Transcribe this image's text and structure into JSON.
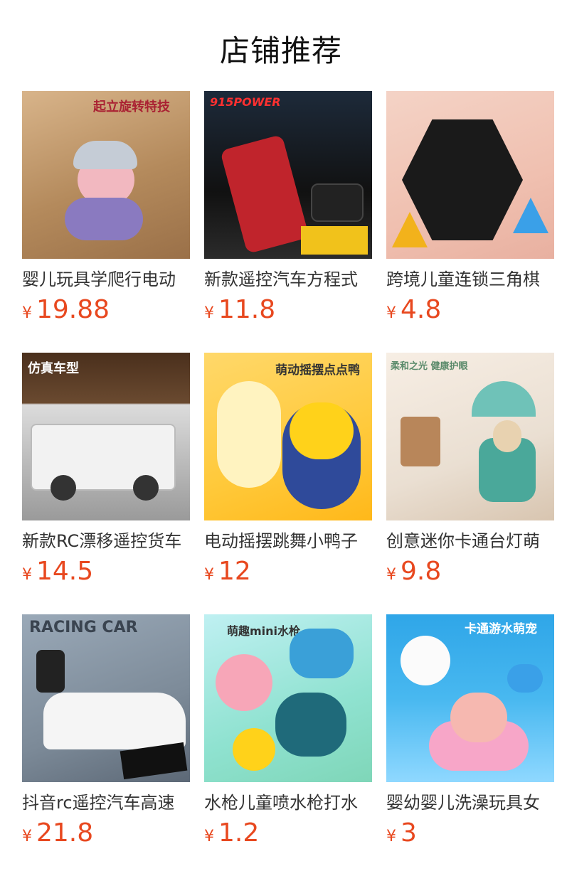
{
  "page": {
    "title": "店铺推荐"
  },
  "products": [
    {
      "name": "婴儿玩具学爬行电动",
      "currency": "¥",
      "price": "19.88",
      "image_text": "起立旋转特技"
    },
    {
      "name": "新款遥控汽车方程式",
      "currency": "¥",
      "price": "11.8",
      "image_text": "915POWER"
    },
    {
      "name": "跨境儿童连锁三角棋",
      "currency": "¥",
      "price": "4.8",
      "image_text": ""
    },
    {
      "name": "新款RC漂移遥控货车",
      "currency": "¥",
      "price": "14.5",
      "image_text": "仿真车型"
    },
    {
      "name": "电动摇摆跳舞小鸭子",
      "currency": "¥",
      "price": "12",
      "image_text": "萌动摇摆点点鸭"
    },
    {
      "name": "创意迷你卡通台灯萌",
      "currency": "¥",
      "price": "9.8",
      "image_text": "柔和之光 健康护眼"
    },
    {
      "name": "抖音rc遥控汽车高速",
      "currency": "¥",
      "price": "21.8",
      "image_text": "RACING CAR"
    },
    {
      "name": "水枪儿童喷水枪打水",
      "currency": "¥",
      "price": "1.2",
      "image_text": "萌趣mini水枪"
    },
    {
      "name": "婴幼婴儿洗澡玩具女",
      "currency": "¥",
      "price": "3",
      "image_text": "卡通游水萌宠"
    }
  ]
}
